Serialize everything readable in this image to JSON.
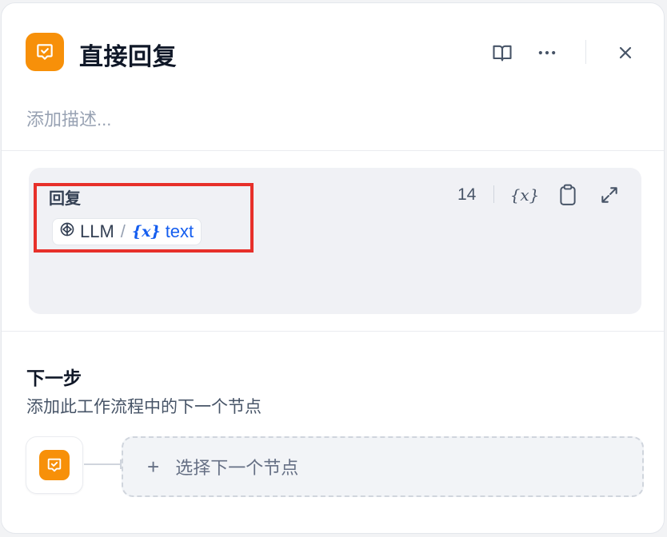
{
  "header": {
    "title": "直接回复",
    "description_placeholder": "添加描述..."
  },
  "reply": {
    "label": "回复",
    "char_count": "14",
    "variable": {
      "source": "LLM",
      "separator": "/",
      "var_icon": "{x}",
      "name": "text"
    },
    "tools": {
      "insert_variable": "{x}"
    }
  },
  "next_step": {
    "title": "下一步",
    "description": "添加此工作流程中的下一个节点",
    "select_label": "选择下一个节点",
    "plus": "+"
  },
  "icons": {
    "node": "answer-node-icon",
    "docs": "book-open-icon",
    "more": "more-horizontal-icon",
    "close": "close-icon",
    "copy": "clipboard-icon",
    "expand": "expand-icon",
    "llm": "llm-icon"
  },
  "colors": {
    "node_accent": "#f79009",
    "variable_blue": "#155eef",
    "highlight_red": "#e7302a"
  }
}
